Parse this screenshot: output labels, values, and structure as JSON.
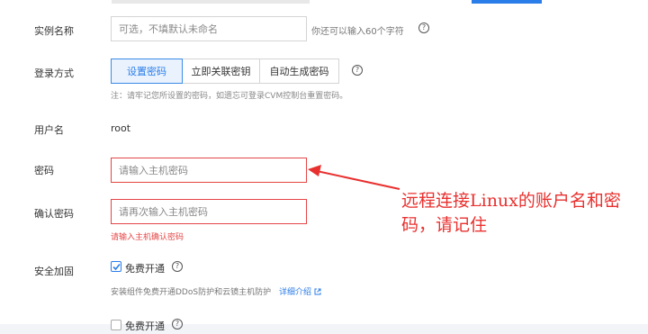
{
  "colors": {
    "accent": "#2b7de9",
    "error": "#e54545",
    "annotation": "#e8312f"
  },
  "instance_name": {
    "label": "实例名称",
    "placeholder": "可选，不填默认未命名",
    "hint": "你还可以输入60个字符"
  },
  "login_method": {
    "label": "登录方式",
    "options": [
      "设置密码",
      "立即关联密钥",
      "自动生成密码"
    ],
    "selected": "设置密码",
    "note": "注：请牢记您所设置的密码，如遗忘可登录CVM控制台重置密码。"
  },
  "username": {
    "label": "用户名",
    "value": "root"
  },
  "password": {
    "label": "密码",
    "placeholder": "请输入主机密码"
  },
  "confirm_password": {
    "label": "确认密码",
    "placeholder": "请再次输入主机密码",
    "error": "请输入主机确认密码"
  },
  "security": {
    "label": "安全加固",
    "checkbox_label": "免费开通",
    "checked": true,
    "desc": "安装组件免费开通DDoS防护和云镜主机防护",
    "link": "详细介绍"
  },
  "next_row": {
    "checkbox_label": "免费开通"
  },
  "annotation": {
    "text": "远程连接Linux的账户名和密码，请记住"
  },
  "icons": {
    "help": "help-circle-icon",
    "external": "external-link-icon",
    "check": "check-icon",
    "arrow": "red-arrow"
  }
}
